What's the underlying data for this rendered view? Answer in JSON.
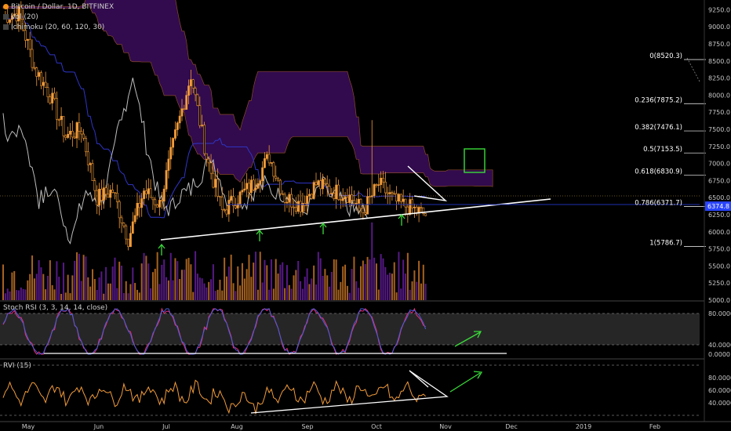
{
  "header": {
    "symbol": "Bitcoin / Dollar, 1D, BITFINEX",
    "vol": "Vol (20)",
    "ichimoku": "Ichimoku (20, 60, 120, 30)"
  },
  "panels": {
    "stoch_title": "Stoch RSI (3, 3, 14, 14, close)",
    "rvi_title": "RVI (15)"
  },
  "colors": {
    "up": "#f39c3a",
    "down": "#f39c3a",
    "volume_up": "#d17a27",
    "volume_down": "#6b1fa8",
    "cloud": "#3a0d5a",
    "kijun": "#2f35c8",
    "lagging": "#bdbdbd",
    "stoch_k": "#4a5bd8",
    "stoch_d": "#e8307c",
    "rvi": "#f39c3a",
    "trend": "#ffffff",
    "arrow": "#3adb3a",
    "price_tag": "#2a44ff"
  },
  "chart_data": {
    "type": "candlestick",
    "title": "Bitcoin / Dollar, 1D, BITFINEX",
    "x_axis": {
      "ticks": [
        "May",
        "Jun",
        "Jul",
        "Aug",
        "Sep",
        "Oct",
        "Nov",
        "Dec",
        "2019",
        "Feb"
      ]
    },
    "price_axis": {
      "ticks": [
        "9250.0",
        "9000.0",
        "8750.0",
        "8500.0",
        "8250.0",
        "8000.0",
        "7750.0",
        "7500.0",
        "7250.0",
        "7000.0",
        "6750.0",
        "6500.0",
        "6250.0",
        "6000.0",
        "5750.0",
        "5500.0",
        "5250.0",
        "5000.0"
      ],
      "ylim": [
        5000,
        9300
      ]
    },
    "last_price": "6374.8",
    "fib_levels": [
      {
        "label": "0(8520.3)",
        "value": 8520.3
      },
      {
        "label": "0.236(7875.2)",
        "value": 7875.2
      },
      {
        "label": "0.382(7476.1)",
        "value": 7476.1
      },
      {
        "label": "0.5(7153.5)",
        "value": 7153.5
      },
      {
        "label": "0.618(6830.9)",
        "value": 6830.9
      },
      {
        "label": "0.786(6371.7)",
        "value": 6371.7
      },
      {
        "label": "1(5786.7)",
        "value": 5786.7
      }
    ],
    "candles": [
      {
        "d": "May 1",
        "o": 9050,
        "h": 9300,
        "c": 9150,
        "l": 8900
      },
      {
        "d": "May 8",
        "o": 9150,
        "h": 9400,
        "c": 9200,
        "l": 8800
      },
      {
        "d": "May 15",
        "o": 8700,
        "h": 8900,
        "c": 8400,
        "l": 8200
      },
      {
        "d": "May 22",
        "o": 8400,
        "h": 8600,
        "c": 8000,
        "l": 7600
      },
      {
        "d": "May 29",
        "o": 7500,
        "h": 7700,
        "c": 7400,
        "l": 7200
      },
      {
        "d": "Jun 5",
        "o": 7600,
        "h": 7750,
        "c": 7500,
        "l": 7350
      },
      {
        "d": "Jun 12",
        "o": 6900,
        "h": 7100,
        "c": 6500,
        "l": 6400
      },
      {
        "d": "Jun 19",
        "o": 6700,
        "h": 6800,
        "c": 6600,
        "l": 6400
      },
      {
        "d": "Jun 26",
        "o": 6200,
        "h": 6300,
        "c": 5900,
        "l": 5800
      },
      {
        "d": "Jul 3",
        "o": 6500,
        "h": 6800,
        "c": 6600,
        "l": 6300
      },
      {
        "d": "Jul 10",
        "o": 6300,
        "h": 6500,
        "c": 6400,
        "l": 6100
      },
      {
        "d": "Jul 17",
        "o": 7300,
        "h": 7500,
        "c": 7400,
        "l": 7200
      },
      {
        "d": "Jul 24",
        "o": 8200,
        "h": 8500,
        "c": 8300,
        "l": 7900
      },
      {
        "d": "Jul 31",
        "o": 7600,
        "h": 7700,
        "c": 7100,
        "l": 6950
      },
      {
        "d": "Aug 7",
        "o": 6400,
        "h": 6500,
        "c": 6300,
        "l": 6000
      },
      {
        "d": "Aug 14",
        "o": 6300,
        "h": 6500,
        "c": 6500,
        "l": 6200
      },
      {
        "d": "Aug 21",
        "o": 6500,
        "h": 6600,
        "c": 6700,
        "l": 6400
      },
      {
        "d": "Aug 28",
        "o": 7000,
        "h": 7300,
        "c": 7100,
        "l": 6900
      },
      {
        "d": "Sep 4",
        "o": 7300,
        "h": 7400,
        "c": 6500,
        "l": 6200
      },
      {
        "d": "Sep 11",
        "o": 6300,
        "h": 6400,
        "c": 6400,
        "l": 6200
      },
      {
        "d": "Sep 18",
        "o": 6500,
        "h": 6700,
        "c": 6700,
        "l": 6400
      },
      {
        "d": "Sep 25",
        "o": 6600,
        "h": 6700,
        "c": 6600,
        "l": 6500
      },
      {
        "d": "Oct 2",
        "o": 6600,
        "h": 6650,
        "c": 6550,
        "l": 6500
      },
      {
        "d": "Oct 9",
        "o": 6600,
        "h": 6650,
        "c": 6300,
        "l": 6200
      },
      {
        "d": "Oct 15",
        "o": 6300,
        "h": 7800,
        "c": 6700,
        "l": 6300
      },
      {
        "d": "Oct 22",
        "o": 6500,
        "h": 6600,
        "c": 6450,
        "l": 6400
      },
      {
        "d": "Oct 29",
        "o": 6400,
        "h": 6500,
        "c": 6350,
        "l": 6300
      }
    ],
    "stoch_rsi": {
      "ticks": [
        "80.0000",
        "40.0000",
        "0.0000"
      ],
      "ylim": [
        0,
        100
      ]
    },
    "rvi": {
      "ticks": [
        "80.0000",
        "60.0000",
        "40.0000"
      ],
      "ylim": [
        20,
        100
      ]
    }
  }
}
